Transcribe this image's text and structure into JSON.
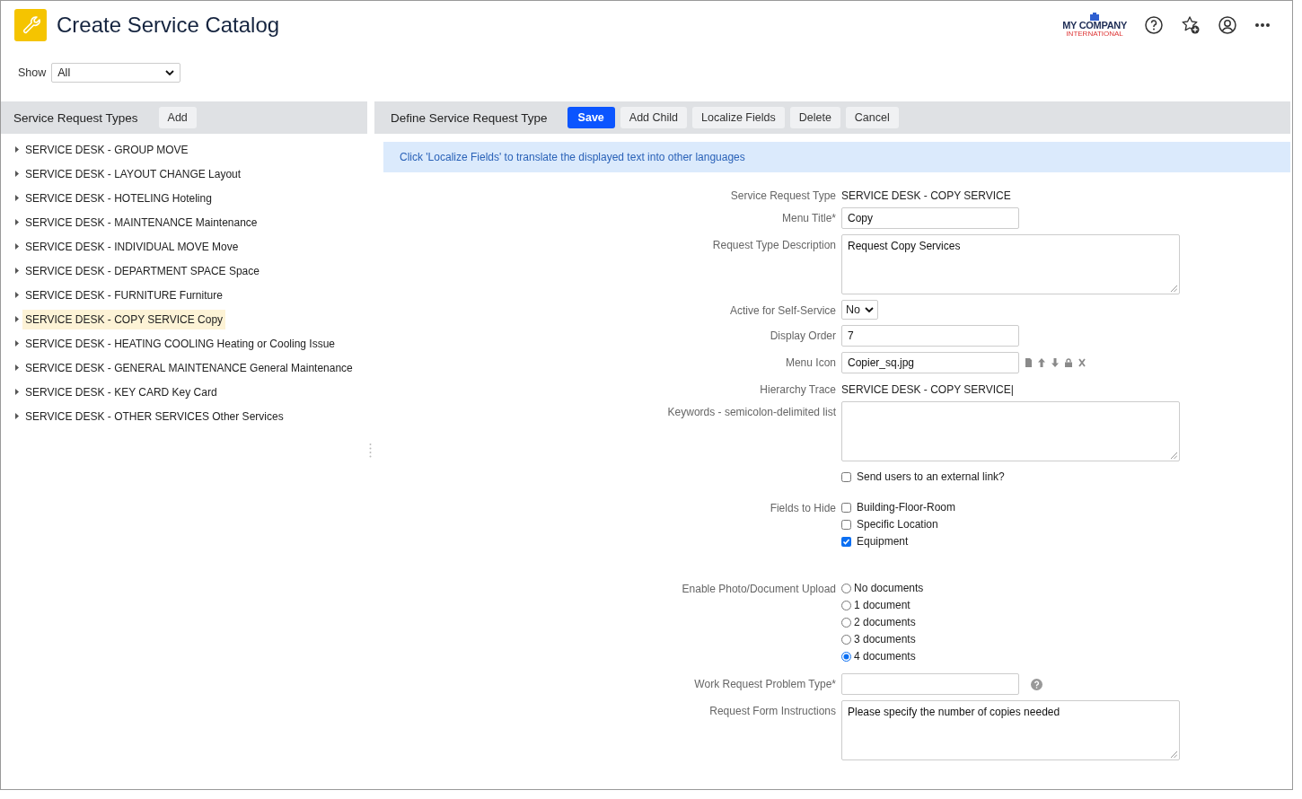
{
  "header": {
    "title": "Create Service Catalog",
    "logo": {
      "name": "MY COMPANY",
      "tagline": "INTERNATIONAL"
    }
  },
  "filter": {
    "label": "Show",
    "value": "All"
  },
  "left_panel": {
    "title": "Service Request Types",
    "add_button": "Add",
    "items": [
      {
        "code": "SERVICE DESK - GROUP MOVE",
        "selected": false
      },
      {
        "code": "SERVICE DESK - LAYOUT CHANGE",
        "title": "Layout",
        "selected": false
      },
      {
        "code": "SERVICE DESK - HOTELING",
        "title": "Hoteling",
        "selected": false
      },
      {
        "code": "SERVICE DESK - MAINTENANCE",
        "title": "Maintenance",
        "selected": false
      },
      {
        "code": "SERVICE DESK - INDIVIDUAL MOVE",
        "title": "Move",
        "selected": false
      },
      {
        "code": "SERVICE DESK - DEPARTMENT SPACE",
        "title": "Space",
        "selected": false
      },
      {
        "code": "SERVICE DESK - FURNITURE",
        "title": "Furniture",
        "selected": false
      },
      {
        "code": "SERVICE DESK - COPY SERVICE",
        "title": "Copy",
        "selected": true
      },
      {
        "code": "SERVICE DESK - HEATING COOLING",
        "title": "Heating or Cooling Issue",
        "selected": false
      },
      {
        "code": "SERVICE DESK - GENERAL MAINTENANCE",
        "title": "General Maintenance",
        "selected": false
      },
      {
        "code": "SERVICE DESK - KEY CARD",
        "title": "Key Card",
        "selected": false
      },
      {
        "code": "SERVICE DESK - OTHER SERVICES",
        "title": "Other Services",
        "selected": false
      }
    ]
  },
  "right_panel": {
    "title": "Define Service Request Type",
    "buttons": [
      {
        "label": "Save",
        "primary": true
      },
      {
        "label": "Add Child",
        "primary": false
      },
      {
        "label": "Localize Fields",
        "primary": false
      },
      {
        "label": "Delete",
        "primary": false
      },
      {
        "label": "Cancel",
        "primary": false
      }
    ],
    "info": "Click 'Localize Fields' to translate the displayed text into other languages",
    "fields": [
      {
        "kind": "text",
        "label": "Service Request Type",
        "value": "SERVICE DESK - COPY SERVICE"
      },
      {
        "kind": "input",
        "label": "Menu Title*",
        "value": "Copy"
      },
      {
        "kind": "textarea",
        "label": "Request Type Description",
        "value": "Request Copy Services"
      },
      {
        "kind": "select",
        "label": "Active for Self-Service",
        "value": "No"
      },
      {
        "kind": "input",
        "label": "Display Order",
        "value": "7"
      },
      {
        "kind": "file",
        "label": "Menu Icon",
        "value": "Copier_sq.jpg"
      },
      {
        "kind": "text",
        "label": "Hierarchy Trace",
        "value": "SERVICE DESK - COPY SERVICE|"
      },
      {
        "kind": "textarea",
        "label": "Keywords - semicolon-delimited list"
      },
      {
        "kind": "checks",
        "options": [
          {
            "label": "Send users to an external link?",
            "checked": false
          }
        ]
      },
      {
        "kind": "checks",
        "label": "Fields to Hide",
        "options": [
          {
            "label": "Building-Floor-Room",
            "checked": false
          },
          {
            "label": "Specific Location",
            "checked": false
          },
          {
            "label": "Equipment",
            "checked": true
          }
        ]
      },
      {
        "kind": "radios",
        "label": "Enable Photo/Document Upload",
        "options": [
          {
            "label": "No documents",
            "selected": false
          },
          {
            "label": "1 document",
            "selected": false
          },
          {
            "label": "2 documents",
            "selected": false
          },
          {
            "label": "3 documents",
            "selected": false
          },
          {
            "label": "4 documents",
            "selected": true
          }
        ]
      },
      {
        "kind": "help",
        "label": "Work Request Problem Type*"
      },
      {
        "kind": "textarea",
        "label": "Request Form Instructions",
        "value": "Please specify the number of copies needed"
      }
    ]
  }
}
